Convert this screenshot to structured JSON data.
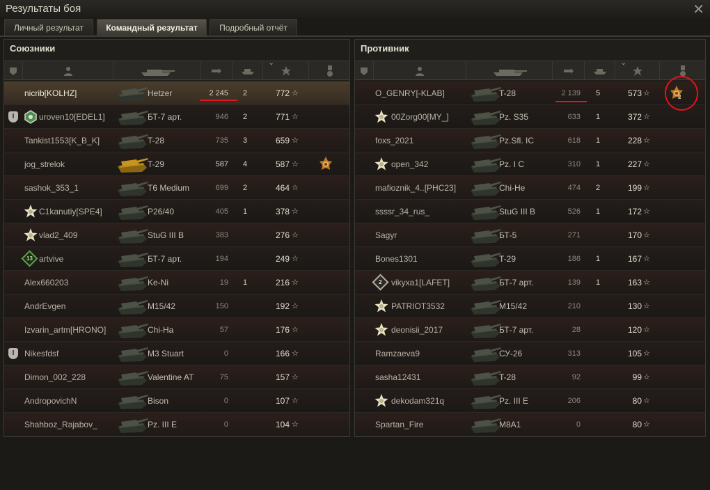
{
  "window": {
    "title": "Результаты боя",
    "close_glyph": "✕"
  },
  "tabs": [
    {
      "label": "Личный результат",
      "active": false
    },
    {
      "label": "Командный результат",
      "active": true
    },
    {
      "label": "Подробный отчёт",
      "active": false
    }
  ],
  "allies": {
    "title": "Союзники",
    "rows": [
      {
        "badge": "",
        "icon": "",
        "name": "nicrib[KOLHZ]",
        "tank": "Hetzer",
        "damage": "2 245",
        "kills": "2",
        "xp": "772",
        "medal": "",
        "me": true
      },
      {
        "badge": "I",
        "icon": "clan-emblem",
        "name": "uroven10[EDEL1]",
        "tank": "БТ-7 арт.",
        "damage": "946",
        "kills": "2",
        "xp": "771",
        "medal": ""
      },
      {
        "badge": "",
        "icon": "",
        "name": "Tankist1553[K_B_K]",
        "tank": "T-28",
        "damage": "735",
        "kills": "3",
        "xp": "659",
        "medal": ""
      },
      {
        "badge": "",
        "icon": "",
        "name": "jog_strelok",
        "tank": "T-29",
        "damage": "587",
        "kills": "4",
        "xp": "587",
        "medal": "order-medal"
      },
      {
        "badge": "",
        "icon": "",
        "name": "sashok_353_1",
        "tank": "T6 Medium",
        "damage": "699",
        "kills": "2",
        "xp": "464",
        "medal": ""
      },
      {
        "badge": "",
        "icon": "star",
        "name": "C1kanutiy[SPE4]",
        "tank": "P26/40",
        "damage": "405",
        "kills": "1",
        "xp": "378",
        "medal": ""
      },
      {
        "badge": "",
        "icon": "star",
        "name": "vlad2_409",
        "tank": "StuG III B",
        "damage": "383",
        "kills": "",
        "xp": "276",
        "medal": ""
      },
      {
        "badge": "",
        "icon": "rank-13",
        "rank_label": "13",
        "name": "artvive",
        "tank": "БТ-7 арт.",
        "damage": "194",
        "kills": "",
        "xp": "249",
        "medal": ""
      },
      {
        "badge": "",
        "icon": "",
        "name": "Alex660203",
        "tank": "Ke-Ni",
        "damage": "19",
        "kills": "1",
        "xp": "216",
        "medal": ""
      },
      {
        "badge": "",
        "icon": "",
        "name": "AndrEvgen",
        "tank": "M15/42",
        "damage": "150",
        "kills": "",
        "xp": "192",
        "medal": ""
      },
      {
        "badge": "",
        "icon": "",
        "name": "Izvarin_artm[HRONO]",
        "tank": "Chi-Ha",
        "damage": "57",
        "kills": "",
        "xp": "176",
        "medal": ""
      },
      {
        "badge": "I",
        "icon": "",
        "name": "Nikesfdsf",
        "tank": "M3 Stuart",
        "damage": "0",
        "kills": "",
        "xp": "166",
        "medal": ""
      },
      {
        "badge": "",
        "icon": "",
        "name": "Dimon_002_228",
        "tank": "Valentine AT",
        "damage": "75",
        "kills": "",
        "xp": "157",
        "medal": ""
      },
      {
        "badge": "",
        "icon": "",
        "name": "AndropovichN",
        "tank": "Bison",
        "damage": "0",
        "kills": "",
        "xp": "107",
        "medal": ""
      },
      {
        "badge": "",
        "icon": "",
        "name": "Shahboz_Rajabov_",
        "tank": "Pz. III E",
        "damage": "0",
        "kills": "",
        "xp": "104",
        "medal": ""
      }
    ]
  },
  "enemies": {
    "title": "Противник",
    "rows": [
      {
        "badge": "",
        "icon": "",
        "name": "O_GENRY[-KLAB]",
        "tank": "T-28",
        "damage": "2 139",
        "kills": "5",
        "xp": "573",
        "medal": "order-medal-2",
        "medal_count": "2"
      },
      {
        "badge": "",
        "icon": "star",
        "name": "00Zorg00[MY_]",
        "tank": "Pz. S35",
        "damage": "633",
        "kills": "1",
        "xp": "372",
        "medal": ""
      },
      {
        "badge": "",
        "icon": "",
        "name": "foxs_2021",
        "tank": "Pz.Sfl. IC",
        "damage": "618",
        "kills": "1",
        "xp": "228",
        "medal": ""
      },
      {
        "badge": "",
        "icon": "star",
        "name": "open_342",
        "tank": "Pz. I C",
        "damage": "310",
        "kills": "1",
        "xp": "227",
        "medal": ""
      },
      {
        "badge": "",
        "icon": "",
        "name": "mafioznik_4..[PHC23]",
        "tank": "Chi-He",
        "damage": "474",
        "kills": "2",
        "xp": "199",
        "medal": ""
      },
      {
        "badge": "",
        "icon": "",
        "name": "ssssr_34_rus_",
        "tank": "StuG III B",
        "damage": "526",
        "kills": "1",
        "xp": "172",
        "medal": ""
      },
      {
        "badge": "",
        "icon": "",
        "name": "Sagyr",
        "tank": "БТ-5",
        "damage": "271",
        "kills": "",
        "xp": "170",
        "medal": ""
      },
      {
        "badge": "",
        "icon": "",
        "name": "Bones1301",
        "tank": "T-29",
        "damage": "186",
        "kills": "1",
        "xp": "167",
        "medal": ""
      },
      {
        "badge": "",
        "icon": "rank-grey",
        "rank_label": "2",
        "name": "vikyxa1[LAFET]",
        "tank": "БТ-7 арт.",
        "damage": "139",
        "kills": "1",
        "xp": "163",
        "medal": ""
      },
      {
        "badge": "",
        "icon": "star",
        "name": "PATRIOT3532",
        "tank": "M15/42",
        "damage": "210",
        "kills": "",
        "xp": "130",
        "medal": ""
      },
      {
        "badge": "",
        "icon": "star",
        "name": "deonisii_2017",
        "tank": "БТ-7 арт.",
        "damage": "28",
        "kills": "",
        "xp": "120",
        "medal": ""
      },
      {
        "badge": "",
        "icon": "",
        "name": "Ramzaeva9",
        "tank": "СУ-26",
        "damage": "313",
        "kills": "",
        "xp": "105",
        "medal": ""
      },
      {
        "badge": "",
        "icon": "",
        "name": "sasha12431",
        "tank": "T-28",
        "damage": "92",
        "kills": "",
        "xp": "99",
        "medal": ""
      },
      {
        "badge": "",
        "icon": "star",
        "name": "dekodam321q",
        "tank": "Pz. III E",
        "damage": "206",
        "kills": "",
        "xp": "80",
        "medal": ""
      },
      {
        "badge": "",
        "icon": "",
        "name": "Spartan_Fire",
        "tank": "M8A1",
        "damage": "0",
        "kills": "",
        "xp": "80",
        "medal": ""
      }
    ]
  },
  "star_glyph": "☆",
  "colors": {
    "annotation": "#e0141b",
    "highlight_row": "#4a3e2d",
    "tank_gold": "#c8951f"
  }
}
